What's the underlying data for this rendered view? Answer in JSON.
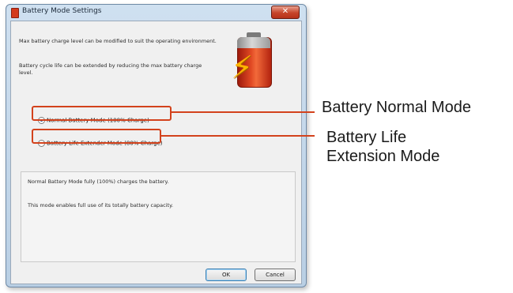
{
  "window": {
    "title": "Battery Mode Settings",
    "close_glyph": "✕"
  },
  "description": {
    "line1": "Max battery charge level can be modified to suit the operating environment.",
    "line2": "Battery cycle life can be extended by reducing the max battery charge level."
  },
  "options": [
    {
      "label": "Normal Battery Mode (100% Charge)",
      "selected": true
    },
    {
      "label": "Battery Life Extender Mode (80% Charge)",
      "selected": false
    }
  ],
  "info": {
    "line1": "Normal Battery Mode fully (100%) charges the battery.",
    "line2": "This mode enables full use of its totally battery capacity."
  },
  "buttons": {
    "ok": "OK",
    "cancel": "Cancel"
  },
  "callouts": {
    "normal": "Battery Normal Mode",
    "life_line1": "Battery Life",
    "life_line2": "Extension Mode"
  },
  "colors": {
    "highlight": "#d3421c",
    "accent_close": "#c6442a"
  },
  "icons": {
    "app": "battery-app-icon",
    "graphic": "battery-lightning-icon"
  }
}
